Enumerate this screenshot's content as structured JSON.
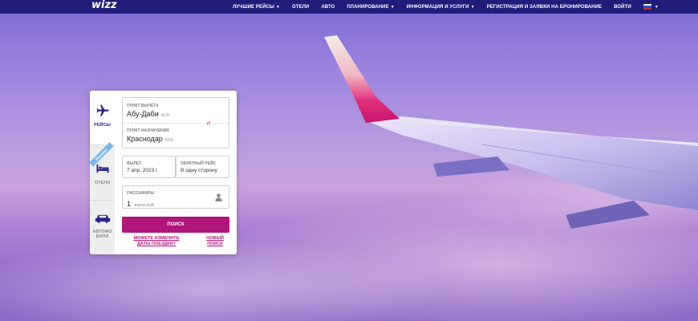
{
  "header": {
    "logo_text": "wizz",
    "nav": [
      {
        "label": "Лучшие рейсы",
        "dropdown": true
      },
      {
        "label": "Отели",
        "dropdown": false
      },
      {
        "label": "Авто",
        "dropdown": false
      },
      {
        "label": "Планирование",
        "dropdown": true
      },
      {
        "label": "Информация и услуги",
        "dropdown": true
      },
      {
        "label": "Регистрация и заявки на бронирование",
        "dropdown": false
      },
      {
        "label": "Войти",
        "dropdown": false
      }
    ],
    "language_flag_colors": [
      "#ffffff",
      "#1f4fc1",
      "#d52b1e"
    ]
  },
  "tabs": {
    "flights": {
      "label": "Рейсы",
      "icon": "plane-icon"
    },
    "hotels": {
      "label": "Отели",
      "icon": "bed-icon",
      "ribbon": "Новинка"
    },
    "cars": {
      "label": "Автомобили",
      "icon": "car-icon"
    }
  },
  "form": {
    "origin": {
      "label": "Пункт вылета",
      "city": "Абу-Даби",
      "code": "AUH"
    },
    "destination": {
      "label": "Пункт назначения",
      "city": "Краснодар",
      "code": "KRR"
    },
    "swap_label": "⇄",
    "departure": {
      "label": "Вылет",
      "value": "7 апр. 2023 г."
    },
    "return": {
      "label": "Обратный рейс",
      "value": "В одну сторону"
    },
    "passengers": {
      "label": "Пассажиры",
      "count": "1",
      "type": "взрослый",
      "icon": "person-icon"
    }
  },
  "actions": {
    "search_label": "Поиск",
    "flexible_dates_label": "Можете изменить даты поездки?",
    "new_search_label": "Новый поиск"
  },
  "colors": {
    "nav_bg": "#1f1c7a",
    "brand_magenta": "#b0157a",
    "brand_purple": "#2a2585"
  }
}
